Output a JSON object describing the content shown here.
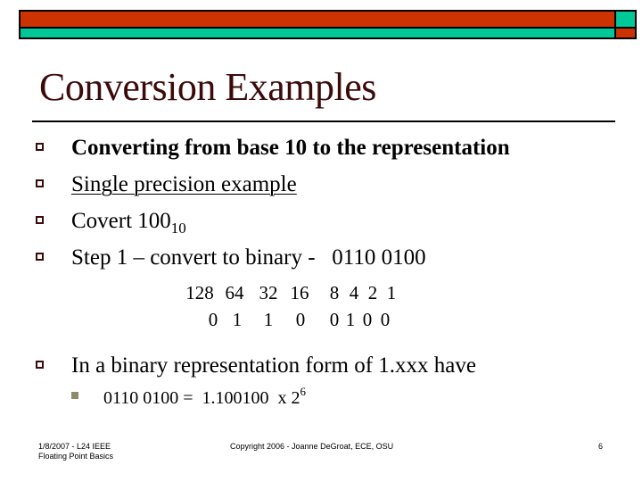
{
  "slide": {
    "title": "Conversion Examples",
    "colors": {
      "accent_red": "#cc3300",
      "accent_teal": "#00c896",
      "title_color": "#3d0a0a"
    },
    "bullets": [
      {
        "text": "Converting from base 10 to the representation",
        "style": "bold"
      },
      {
        "text": "Single precision example",
        "style": "underline"
      },
      {
        "text_main": "Covert 100",
        "text_sub": "10",
        "style": "normal"
      },
      {
        "text": "Step 1 – convert to binary -   0110 0100",
        "style": "normal"
      },
      {
        "text": "In a binary representation form of 1.xxx have",
        "style": "normal"
      }
    ],
    "bit_table": {
      "weights": [
        "128",
        "64",
        "32",
        "16",
        "8",
        "4",
        "2",
        "1"
      ],
      "bits": [
        "0",
        "1",
        "1",
        "0",
        "0",
        "1",
        "0",
        "0"
      ]
    },
    "sub_bullet": {
      "text_main": "0110 0100 =  1.100100  x 2",
      "text_sup": "6"
    },
    "footer": {
      "date_line1": "1/8/2007 - L24 IEEE",
      "date_line2": "Floating Point Basics",
      "copyright": "Copyright 2006 - Joanne DeGroat, ECE, OSU",
      "page_number": "6"
    }
  }
}
